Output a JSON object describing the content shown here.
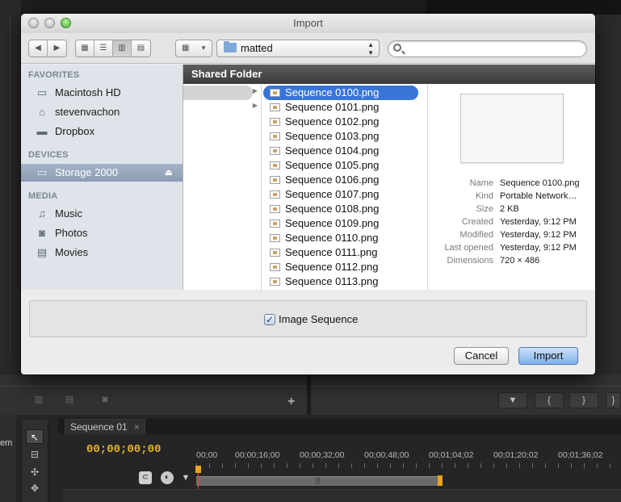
{
  "dialog": {
    "title": "Import",
    "toolbar": {
      "nav_back": "◀",
      "nav_forward": "▶",
      "view_icons": [
        "▦",
        "☰",
        "▥",
        "▤"
      ],
      "arrange": "▦",
      "path_popup": "matted",
      "search_placeholder": ""
    },
    "sidebar": {
      "sections": [
        {
          "header": "FAVORITES",
          "items": [
            {
              "label": "Macintosh HD",
              "icon": "hard-drive-icon"
            },
            {
              "label": "stevenvachon",
              "icon": "home-icon"
            },
            {
              "label": "Dropbox",
              "icon": "folder-icon"
            }
          ]
        },
        {
          "header": "DEVICES",
          "items": [
            {
              "label": "Storage 2000",
              "icon": "external-drive-icon",
              "selected": true
            }
          ]
        },
        {
          "header": "MEDIA",
          "items": [
            {
              "label": "Music",
              "icon": "music-icon"
            },
            {
              "label": "Photos",
              "icon": "camera-icon"
            },
            {
              "label": "Movies",
              "icon": "film-icon"
            }
          ]
        }
      ]
    },
    "path_bar": "Shared Folder",
    "files": [
      "Sequence 0100.png",
      "Sequence 0101.png",
      "Sequence 0102.png",
      "Sequence 0103.png",
      "Sequence 0104.png",
      "Sequence 0105.png",
      "Sequence 0106.png",
      "Sequence 0107.png",
      "Sequence 0108.png",
      "Sequence 0109.png",
      "Sequence 0110.png",
      "Sequence 0111.png",
      "Sequence 0112.png",
      "Sequence 0113.png"
    ],
    "selected_file_index": 0,
    "info": [
      {
        "key": "Name",
        "value": "Sequence 0100.png"
      },
      {
        "key": "Kind",
        "value": "Portable Network…"
      },
      {
        "key": "Size",
        "value": "2 KB"
      },
      {
        "key": "Created",
        "value": "Yesterday, 9:12 PM"
      },
      {
        "key": "Modified",
        "value": "Yesterday, 9:12 PM"
      },
      {
        "key": "Last opened",
        "value": "Yesterday, 9:12 PM"
      },
      {
        "key": "Dimensions",
        "value": "720 × 486"
      }
    ],
    "image_sequence_label": "Image Sequence",
    "image_sequence_checked": true,
    "cancel_label": "Cancel",
    "import_label": "Import"
  },
  "background": {
    "timeline_tab": "Sequence 01",
    "timeline_tab_close": "×",
    "timecode": "00;00;00;00",
    "left_label": "em",
    "ruler_labels": [
      "00;00",
      "00;00;16;00",
      "00;00;32;00",
      "00;00;48;00",
      "00;01;04;02",
      "00;01;20;02",
      "00;01;36;02"
    ],
    "add_button": "+",
    "marker_buttons": [
      "▼",
      "{",
      "}",
      "}"
    ]
  },
  "colors": {
    "selection_blue": "#3875d7",
    "timecode_orange": "#e8b22a",
    "sidebar_bg": "#dfe4ea"
  }
}
